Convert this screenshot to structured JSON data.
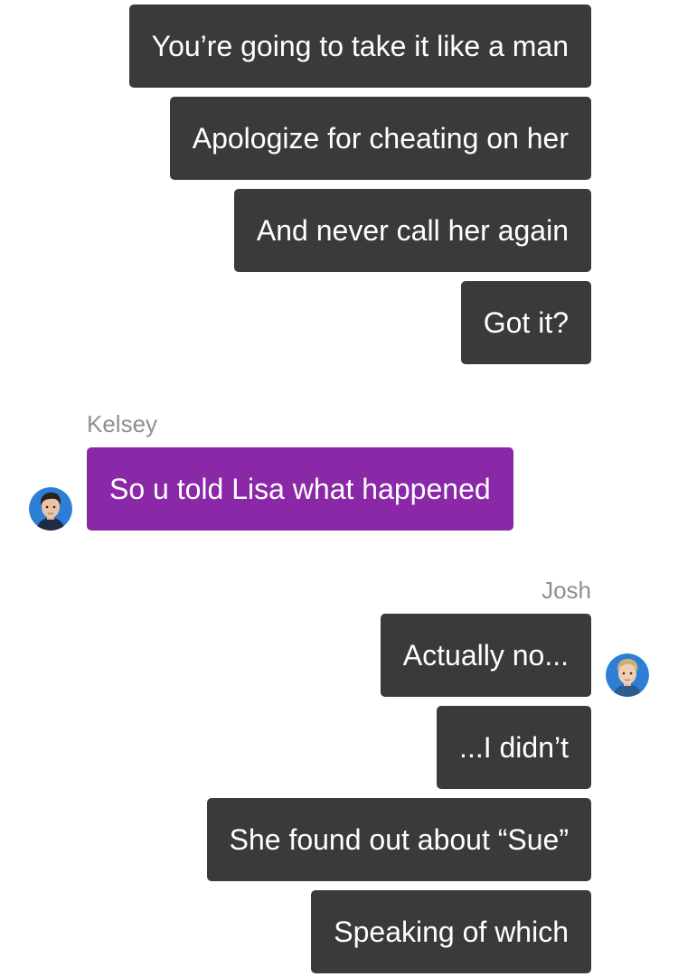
{
  "conversation": {
    "messages_top": [
      {
        "text": "You’re going to take it like a man"
      },
      {
        "text": "Apologize for cheating on her"
      },
      {
        "text": "And never call her again"
      },
      {
        "text": "Got it?"
      }
    ],
    "kelsey": {
      "sender": "Kelsey",
      "avatar_icon": "person-avatar-icon",
      "message": "So u told Lisa what happened",
      "bubble_color": "#8a28a8"
    },
    "josh": {
      "sender": "Josh",
      "avatar_icon": "person-avatar-icon",
      "messages": [
        {
          "text": "Actually no..."
        },
        {
          "text": "...I didn’t"
        },
        {
          "text": "She found out about “Sue”"
        },
        {
          "text": "Speaking of which"
        }
      ],
      "bubble_color": "#3a3a3a"
    }
  }
}
